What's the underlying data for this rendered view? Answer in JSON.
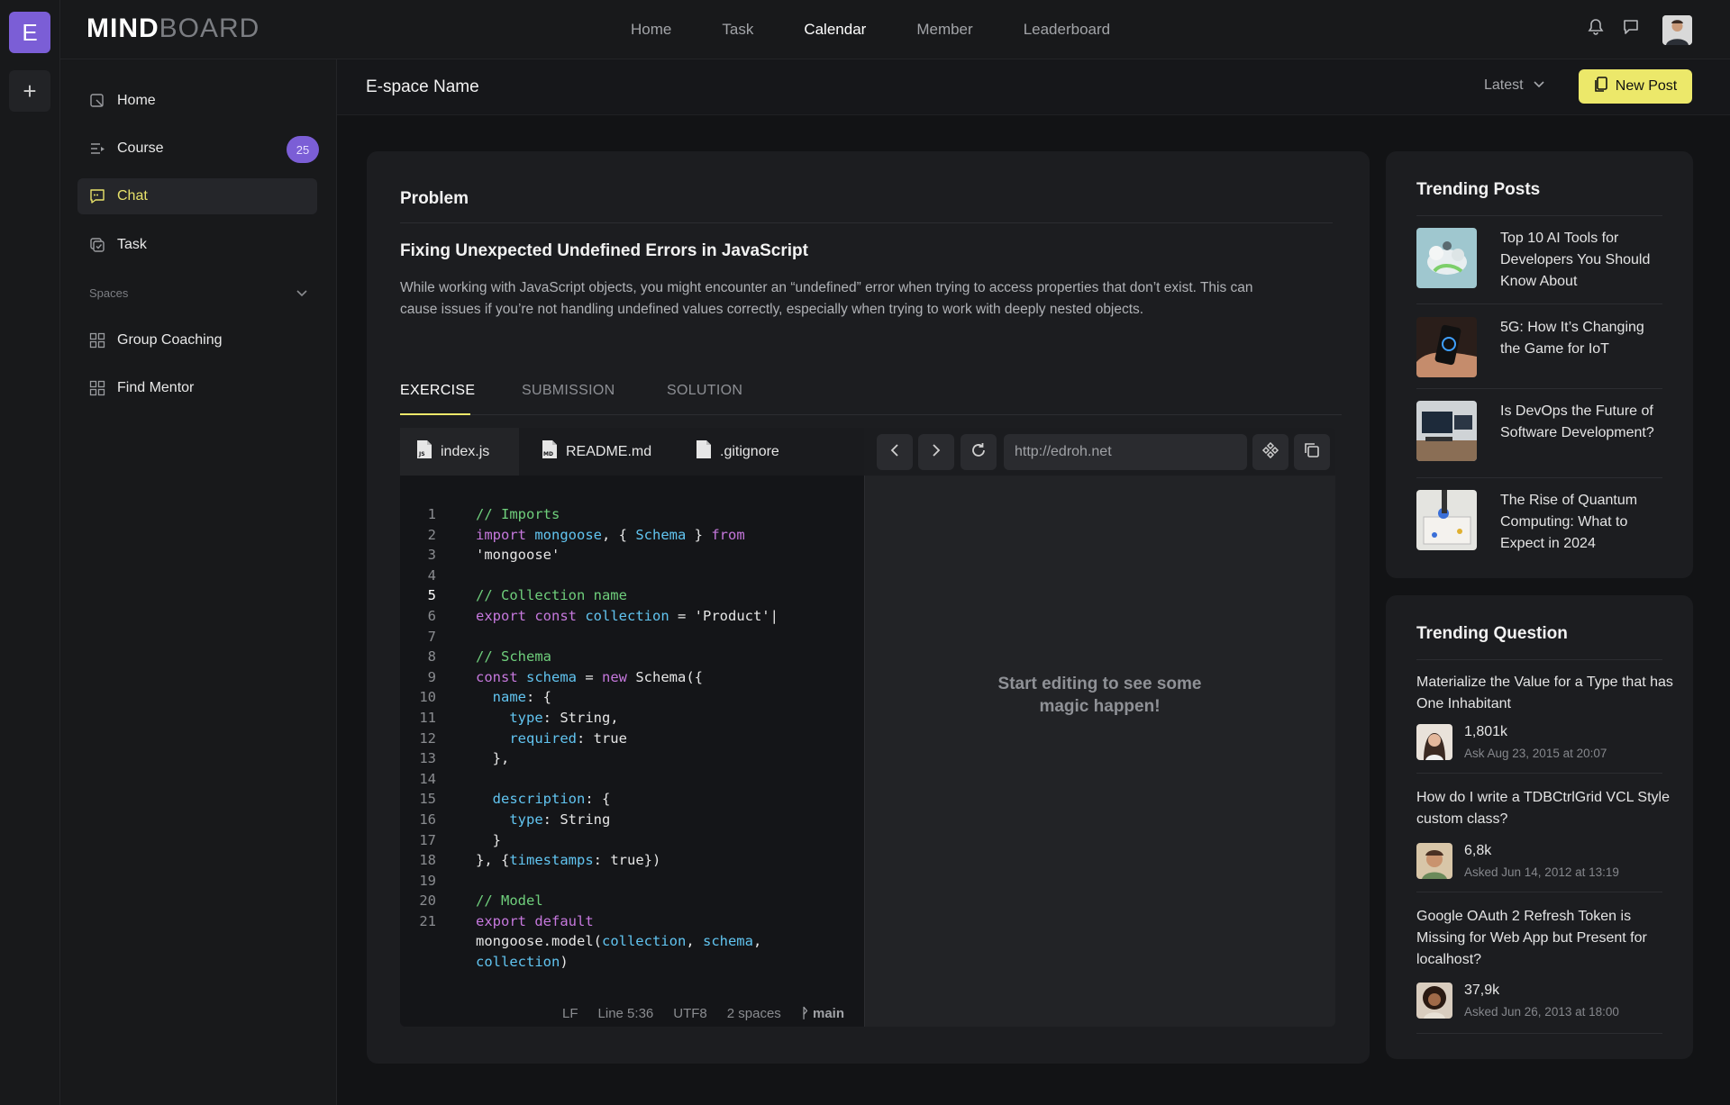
{
  "workspace": {
    "initial": "E",
    "add_symbol": "+"
  },
  "brand": {
    "part1": "MIND",
    "part2": "BOARD"
  },
  "top_nav": [
    {
      "label": "Home"
    },
    {
      "label": "Task"
    },
    {
      "label": "Calendar",
      "active": true
    },
    {
      "label": "Member"
    },
    {
      "label": "Leaderboard"
    }
  ],
  "sidebar": {
    "items": [
      {
        "label": "Home",
        "icon": "home-icon"
      },
      {
        "label": "Course",
        "icon": "course-icon",
        "badge": "25"
      },
      {
        "label": "Chat",
        "icon": "chat-icon",
        "active": true
      },
      {
        "label": "Task",
        "icon": "task-icon"
      }
    ],
    "spaces_label": "Spaces",
    "spaces": [
      {
        "label": "Group Coaching",
        "icon": "grid-icon"
      },
      {
        "label": "Find Mentor",
        "icon": "grid-icon"
      }
    ]
  },
  "header": {
    "title": "E-space Name",
    "sort_label": "Latest",
    "new_post_label": "New Post"
  },
  "problem": {
    "section_title": "Problem",
    "title": "Fixing Unexpected Undefined Errors in JavaScript",
    "description": "While working with JavaScript objects, you might encounter an “undefined” error when trying to access properties that don’t exist. This can cause issues if you’re not handling undefined values correctly, especially when trying to work with deeply nested objects.",
    "tabs": [
      {
        "label": "EXERCISE",
        "active": true
      },
      {
        "label": "SUBMISSION"
      },
      {
        "label": "SOLUTION"
      }
    ]
  },
  "editor": {
    "files": [
      {
        "name": "index.js",
        "icon": "js-file-icon",
        "active": true
      },
      {
        "name": "README.md",
        "icon": "md-file-icon"
      },
      {
        "name": ".gitignore",
        "icon": "file-icon"
      }
    ],
    "current_line": 5,
    "status": {
      "eol": "LF",
      "position": "Line 5:36",
      "encoding": "UTF8",
      "indent": "2 spaces",
      "branch": "main"
    }
  },
  "preview": {
    "url": "http://edroh.net",
    "message_line1": "Start editing to see some",
    "message_line2": "magic happen!"
  },
  "trending_posts": {
    "title": "Trending Posts",
    "items": [
      {
        "title": "Top 10 AI Tools for Developers You Should Know About"
      },
      {
        "title": "5G: How It’s Changing the Game for IoT"
      },
      {
        "title": "Is DevOps the Future of Software Development?"
      },
      {
        "title": "The Rise of Quantum Computing: What to Expect in 2024"
      }
    ]
  },
  "trending_questions": {
    "title": "Trending Question",
    "items": [
      {
        "title": "Materialize the Value for a Type that has One Inhabitant",
        "count": "1,801k",
        "meta": "Ask Aug 23, 2015 at 20:07"
      },
      {
        "title": "How do I write a TDBCtrlGrid VCL Style custom class?",
        "count": "6,8k",
        "meta": "Asked Jun 14, 2012 at 13:19"
      },
      {
        "title": "Google OAuth 2 Refresh Token is Missing for Web App but Present for localhost?",
        "count": "37,9k",
        "meta": "Asked Jun 26, 2013 at 18:00"
      }
    ]
  },
  "colors": {
    "accent": "#ece86a",
    "brand_purple": "#7b5ed6",
    "background": "#121315"
  }
}
